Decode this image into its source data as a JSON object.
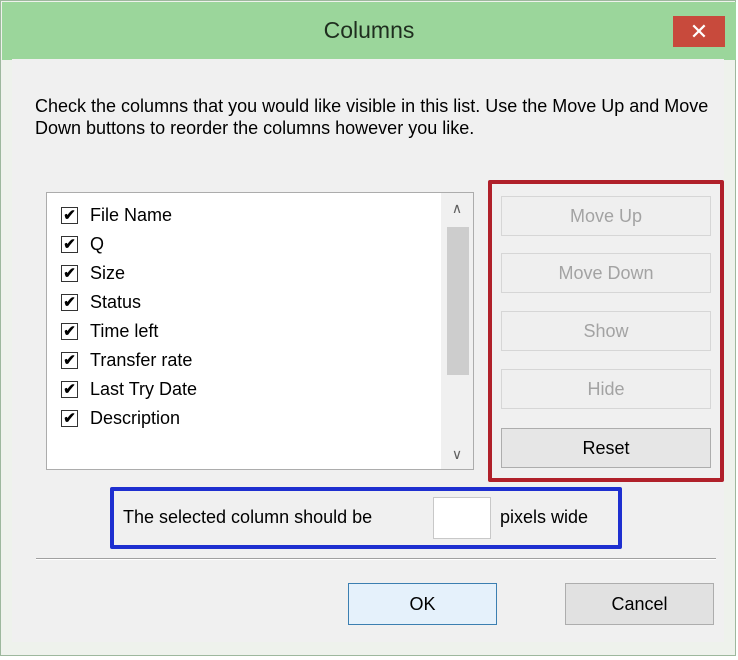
{
  "window": {
    "title": "Columns",
    "close_glyph": "✕"
  },
  "instruction": "Check the columns that you would like visible in this list. Use the Move Up and Move Down buttons to reorder the columns however you like.",
  "columns_list": {
    "items": [
      {
        "label": "File Name",
        "checked": true
      },
      {
        "label": "Q",
        "checked": true
      },
      {
        "label": "Size",
        "checked": true
      },
      {
        "label": "Status",
        "checked": true
      },
      {
        "label": "Time left",
        "checked": true
      },
      {
        "label": "Transfer rate",
        "checked": true
      },
      {
        "label": "Last Try Date",
        "checked": true
      },
      {
        "label": "Description",
        "checked": true
      }
    ],
    "check_glyph": "✔",
    "scroll_up_glyph": "∧",
    "scroll_down_glyph": "∨"
  },
  "side_buttons": {
    "move_up": {
      "label": "Move Up",
      "enabled": false
    },
    "move_down": {
      "label": "Move Down",
      "enabled": false
    },
    "show": {
      "label": "Show",
      "enabled": false
    },
    "hide": {
      "label": "Hide",
      "enabled": false
    },
    "reset": {
      "label": "Reset",
      "enabled": true
    }
  },
  "column_width": {
    "label_before": "The selected column should be",
    "value": "",
    "label_after": "pixels wide"
  },
  "footer": {
    "ok_label": "OK",
    "cancel_label": "Cancel"
  },
  "colors": {
    "titlebar": "#9bd69b",
    "close_button": "#c84a3c",
    "button_group_highlight": "#b0202a",
    "width_field_highlight": "#1e2fd0"
  }
}
